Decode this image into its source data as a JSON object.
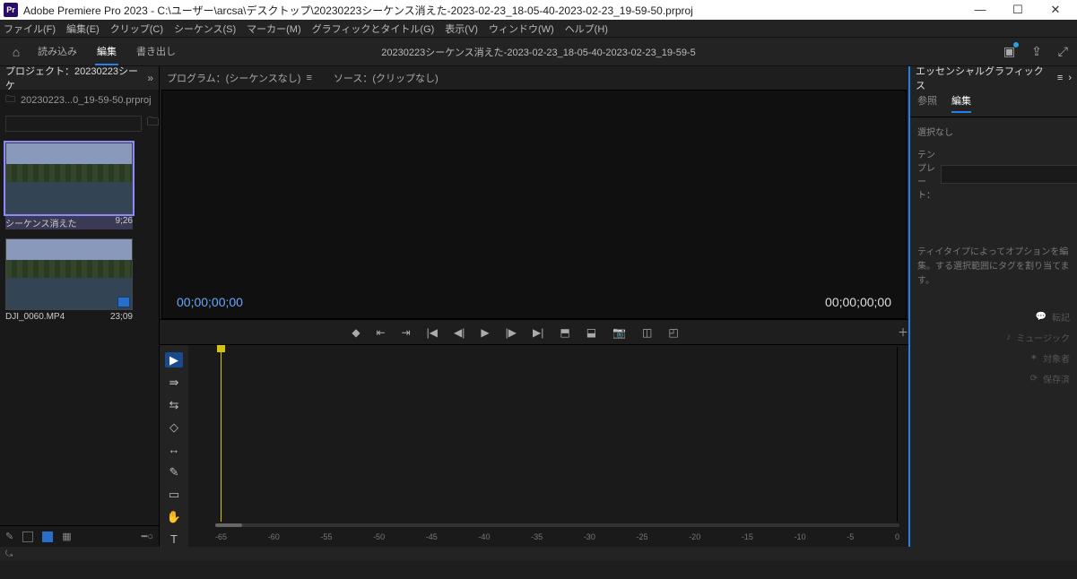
{
  "titlebar": {
    "app_abbrev": "Pr",
    "title": "Adobe Premiere Pro 2023 - C:\\ユーザー\\arcsa\\デスクトップ\\20230223シーケンス消えた-2023-02-23_18-05-40-2023-02-23_19-59-50.prproj"
  },
  "menu": [
    "ファイル(F)",
    "編集(E)",
    "クリップ(C)",
    "シーケンス(S)",
    "マーカー(M)",
    "グラフィックとタイトル(G)",
    "表示(V)",
    "ウィンドウ(W)",
    "ヘルプ(H)"
  ],
  "workspace": {
    "tabs": [
      "読み込み",
      "編集",
      "書き出し"
    ],
    "active_index": 1,
    "docname": "20230223シーケンス消えた-2023-02-23_18-05-40-2023-02-23_19-59-5"
  },
  "project": {
    "title": "プロジェクト：20230223シーケ",
    "bin": "20230223...0_19-59-50.prproj",
    "search_placeholder": "",
    "clips": [
      {
        "name": "シーケンス消えた",
        "dur": "9;26",
        "selected": true
      },
      {
        "name": "DJI_0060.MP4",
        "dur": "23;09",
        "selected": false,
        "video_badge": true
      }
    ]
  },
  "program": {
    "title": "プログラム：(シーケンスなし)",
    "source_title": "ソース：(クリップなし)",
    "tc_left": "00;00;00;00",
    "tc_right": "00;00;00;00"
  },
  "timeline": {
    "ruler": [
      "-65",
      "-60",
      "-55",
      "-50",
      "-45",
      "-40",
      "-35",
      "-30",
      "-25",
      "-20",
      "-15",
      "-10",
      "-5",
      "0"
    ]
  },
  "eg": {
    "title": "エッセンシャルグラフィックス",
    "tabs": [
      "参照",
      "編集"
    ],
    "active_index": 1,
    "nosel": "選択なし",
    "template_label": "テンプレート：",
    "hint": "ティイタイプによってオプションを編集。する選択範囲にタグを割り当てます。",
    "actions": [
      "転記",
      "ミュージック",
      "対象者",
      "保存済"
    ]
  },
  "status": "⤿"
}
